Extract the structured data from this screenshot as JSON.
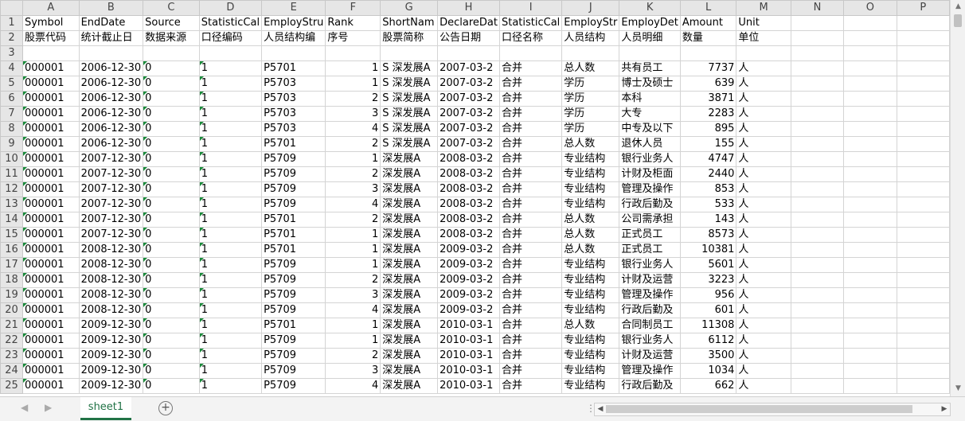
{
  "columns": [
    "A",
    "B",
    "C",
    "D",
    "E",
    "F",
    "G",
    "H",
    "I",
    "J",
    "K",
    "L",
    "M",
    "N",
    "O",
    "P"
  ],
  "rows": [
    {
      "n": "1",
      "c": [
        "Symbol",
        "EndDate",
        "Source",
        "StatisticCal",
        "EmployStru",
        "Rank",
        "ShortNam",
        "DeclareDat",
        "StatisticCal",
        "EmployStr",
        "EmployDet",
        "Amount",
        "Unit",
        "",
        "",
        ""
      ]
    },
    {
      "n": "2",
      "c": [
        "股票代码",
        "统计截止日",
        "数据来源",
        "口径编码",
        "人员结构编",
        "序号",
        "股票简称",
        "公告日期",
        "口径名称",
        "人员结构",
        "人员明细",
        "数量",
        "单位",
        "",
        "",
        ""
      ]
    },
    {
      "n": "3",
      "c": [
        "",
        "",
        "",
        "",
        "",
        "",
        "",
        "",
        "",
        "",
        "",
        "",
        "",
        "",
        "",
        ""
      ]
    },
    {
      "n": "4",
      "c": [
        "000001",
        "2006-12-30",
        "0",
        "1",
        "P5701",
        "1",
        "S 深发展A",
        "2007-03-2",
        "合并",
        "总人数",
        "共有员工",
        "7737",
        "人",
        "",
        "",
        ""
      ]
    },
    {
      "n": "5",
      "c": [
        "000001",
        "2006-12-30",
        "0",
        "1",
        "P5703",
        "1",
        "S 深发展A",
        "2007-03-2",
        "合并",
        "学历",
        "博士及硕士",
        "639",
        "人",
        "",
        "",
        ""
      ]
    },
    {
      "n": "6",
      "c": [
        "000001",
        "2006-12-30",
        "0",
        "1",
        "P5703",
        "2",
        "S 深发展A",
        "2007-03-2",
        "合并",
        "学历",
        "本科",
        "3871",
        "人",
        "",
        "",
        ""
      ]
    },
    {
      "n": "7",
      "c": [
        "000001",
        "2006-12-30",
        "0",
        "1",
        "P5703",
        "3",
        "S 深发展A",
        "2007-03-2",
        "合并",
        "学历",
        "大专",
        "2283",
        "人",
        "",
        "",
        ""
      ]
    },
    {
      "n": "8",
      "c": [
        "000001",
        "2006-12-30",
        "0",
        "1",
        "P5703",
        "4",
        "S 深发展A",
        "2007-03-2",
        "合并",
        "学历",
        "中专及以下",
        "895",
        "人",
        "",
        "",
        ""
      ]
    },
    {
      "n": "9",
      "c": [
        "000001",
        "2006-12-30",
        "0",
        "1",
        "P5701",
        "2",
        "S 深发展A",
        "2007-03-2",
        "合并",
        "总人数",
        "退休人员",
        "155",
        "人",
        "",
        "",
        ""
      ]
    },
    {
      "n": "10",
      "c": [
        "000001",
        "2007-12-30",
        "0",
        "1",
        "P5709",
        "1",
        "深发展A",
        "2008-03-2",
        "合并",
        "专业结构",
        "银行业务人",
        "4747",
        "人",
        "",
        "",
        ""
      ]
    },
    {
      "n": "11",
      "c": [
        "000001",
        "2007-12-30",
        "0",
        "1",
        "P5709",
        "2",
        "深发展A",
        "2008-03-2",
        "合并",
        "专业结构",
        "计财及柜面",
        "2440",
        "人",
        "",
        "",
        ""
      ]
    },
    {
      "n": "12",
      "c": [
        "000001",
        "2007-12-30",
        "0",
        "1",
        "P5709",
        "3",
        "深发展A",
        "2008-03-2",
        "合并",
        "专业结构",
        "管理及操作",
        "853",
        "人",
        "",
        "",
        ""
      ]
    },
    {
      "n": "13",
      "c": [
        "000001",
        "2007-12-30",
        "0",
        "1",
        "P5709",
        "4",
        "深发展A",
        "2008-03-2",
        "合并",
        "专业结构",
        "行政后勤及",
        "533",
        "人",
        "",
        "",
        ""
      ]
    },
    {
      "n": "14",
      "c": [
        "000001",
        "2007-12-30",
        "0",
        "1",
        "P5701",
        "2",
        "深发展A",
        "2008-03-2",
        "合并",
        "总人数",
        "公司需承担",
        "143",
        "人",
        "",
        "",
        ""
      ]
    },
    {
      "n": "15",
      "c": [
        "000001",
        "2007-12-30",
        "0",
        "1",
        "P5701",
        "1",
        "深发展A",
        "2008-03-2",
        "合并",
        "总人数",
        "正式员工",
        "8573",
        "人",
        "",
        "",
        ""
      ]
    },
    {
      "n": "16",
      "c": [
        "000001",
        "2008-12-30",
        "0",
        "1",
        "P5701",
        "1",
        "深发展A",
        "2009-03-2",
        "合并",
        "总人数",
        "正式员工",
        "10381",
        "人",
        "",
        "",
        ""
      ]
    },
    {
      "n": "17",
      "c": [
        "000001",
        "2008-12-30",
        "0",
        "1",
        "P5709",
        "1",
        "深发展A",
        "2009-03-2",
        "合并",
        "专业结构",
        "银行业务人",
        "5601",
        "人",
        "",
        "",
        ""
      ]
    },
    {
      "n": "18",
      "c": [
        "000001",
        "2008-12-30",
        "0",
        "1",
        "P5709",
        "2",
        "深发展A",
        "2009-03-2",
        "合并",
        "专业结构",
        "计财及运营",
        "3223",
        "人",
        "",
        "",
        ""
      ]
    },
    {
      "n": "19",
      "c": [
        "000001",
        "2008-12-30",
        "0",
        "1",
        "P5709",
        "3",
        "深发展A",
        "2009-03-2",
        "合并",
        "专业结构",
        "管理及操作",
        "956",
        "人",
        "",
        "",
        ""
      ]
    },
    {
      "n": "20",
      "c": [
        "000001",
        "2008-12-30",
        "0",
        "1",
        "P5709",
        "4",
        "深发展A",
        "2009-03-2",
        "合并",
        "专业结构",
        "行政后勤及",
        "601",
        "人",
        "",
        "",
        ""
      ]
    },
    {
      "n": "21",
      "c": [
        "000001",
        "2009-12-30",
        "0",
        "1",
        "P5701",
        "1",
        "深发展A",
        "2010-03-1",
        "合并",
        "总人数",
        "合同制员工",
        "11308",
        "人",
        "",
        "",
        ""
      ]
    },
    {
      "n": "22",
      "c": [
        "000001",
        "2009-12-30",
        "0",
        "1",
        "P5709",
        "1",
        "深发展A",
        "2010-03-1",
        "合并",
        "专业结构",
        "银行业务人",
        "6112",
        "人",
        "",
        "",
        ""
      ]
    },
    {
      "n": "23",
      "c": [
        "000001",
        "2009-12-30",
        "0",
        "1",
        "P5709",
        "2",
        "深发展A",
        "2010-03-1",
        "合并",
        "专业结构",
        "计财及运营",
        "3500",
        "人",
        "",
        "",
        ""
      ]
    },
    {
      "n": "24",
      "c": [
        "000001",
        "2009-12-30",
        "0",
        "1",
        "P5709",
        "3",
        "深发展A",
        "2010-03-1",
        "合并",
        "专业结构",
        "管理及操作",
        "1034",
        "人",
        "",
        "",
        ""
      ]
    },
    {
      "n": "25",
      "c": [
        "000001",
        "2009-12-30",
        "0",
        "1",
        "P5709",
        "4",
        "深发展A",
        "2010-03-1",
        "合并",
        "专业结构",
        "行政后勤及",
        "662",
        "人",
        "",
        "",
        ""
      ]
    }
  ],
  "sheet_tab": "sheet1",
  "add_sheet_symbol": "⊕",
  "nav_prev": "◀",
  "nav_next": "▶",
  "scroll_up": "▲",
  "scroll_down": "▼",
  "scroll_left": "◀",
  "scroll_right": "▶",
  "divider": "⋮"
}
